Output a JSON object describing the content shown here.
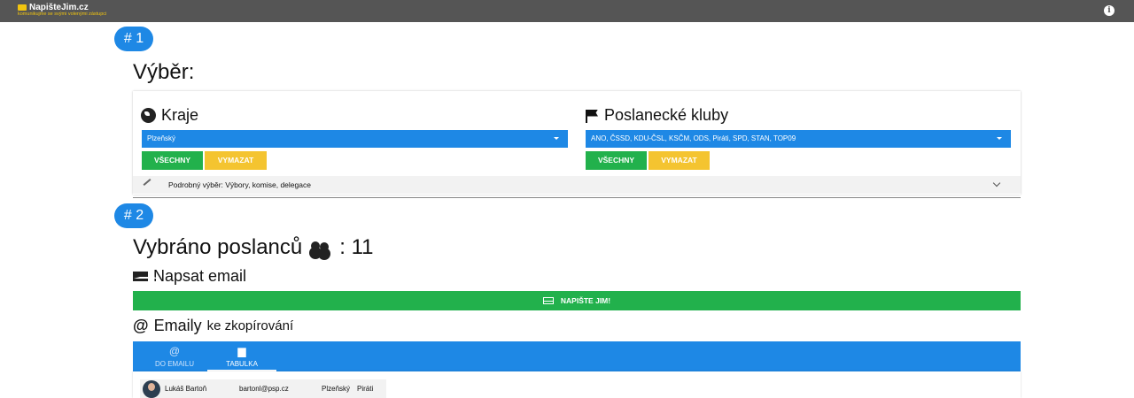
{
  "app": {
    "title": "NapišteJim.cz",
    "subtitle": "komunikujme se svými volenými zástupci"
  },
  "step1": {
    "badge": "# 1",
    "heading": "Výběr:",
    "regions": {
      "title": "Kraje",
      "selected": "Plzeňský",
      "all_label": "VŠECHNY",
      "clear_label": "VYMAZAT"
    },
    "clubs": {
      "title": "Poslanecké kluby",
      "selected": "ANO, ČSSD, KDU-ČSL, KSČM, ODS, Piráti, SPD, STAN, TOP09",
      "all_label": "VŠECHNY",
      "clear_label": "VYMAZAT"
    },
    "detail_label": "Podrobný výběr: Výbory, komise, delegace"
  },
  "step2": {
    "badge": "# 2",
    "heading": "Vybráno poslanců",
    "count": ": 11",
    "write_email_title": "Napsat email",
    "send_button": "NAPIŠTE JIM!",
    "emails_title": "Emaily",
    "emails_suffix": "ke zkopírování",
    "tabs": [
      {
        "label": "DO EMAILU",
        "icon": "at-icon"
      },
      {
        "label": "TABULKA",
        "icon": "document-icon"
      }
    ],
    "rows": [
      {
        "name": "Lukáš Bartoň",
        "email": "bartonl@psp.cz",
        "region": "Plzeňský",
        "club": "Piráti"
      }
    ]
  },
  "colors": {
    "topbar": "#555555",
    "primary": "#1e88e5",
    "success": "#22b14c",
    "warning": "#f4c430",
    "brand_accent": "#f1c40f"
  }
}
